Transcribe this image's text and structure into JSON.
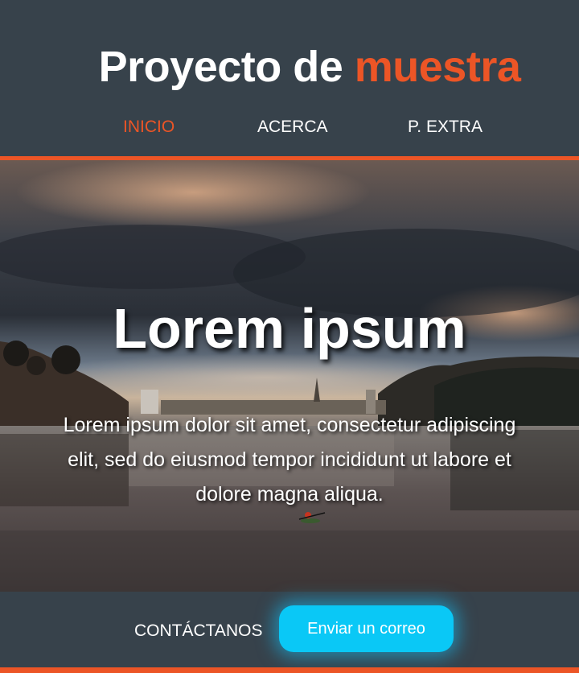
{
  "header": {
    "brand_prefix": "Proyecto de",
    "brand_accent": "muestra",
    "nav": [
      {
        "label": "INICIO",
        "active": true
      },
      {
        "label": "ACERCA",
        "active": false
      },
      {
        "label": "P. EXTRA",
        "active": false
      }
    ]
  },
  "hero": {
    "title": "Lorem ipsum",
    "text": "Lorem ipsum dolor sit amet, consectetur adipiscing elit, sed do eiusmod tempor incididunt ut labore et dolore magna aliqua."
  },
  "footer": {
    "contact_label": "CONTÁCTANOS",
    "email_button": "Enviar un correo"
  },
  "colors": {
    "background": "#37424b",
    "accent": "#ec5526",
    "button": "#0ac8f6"
  }
}
